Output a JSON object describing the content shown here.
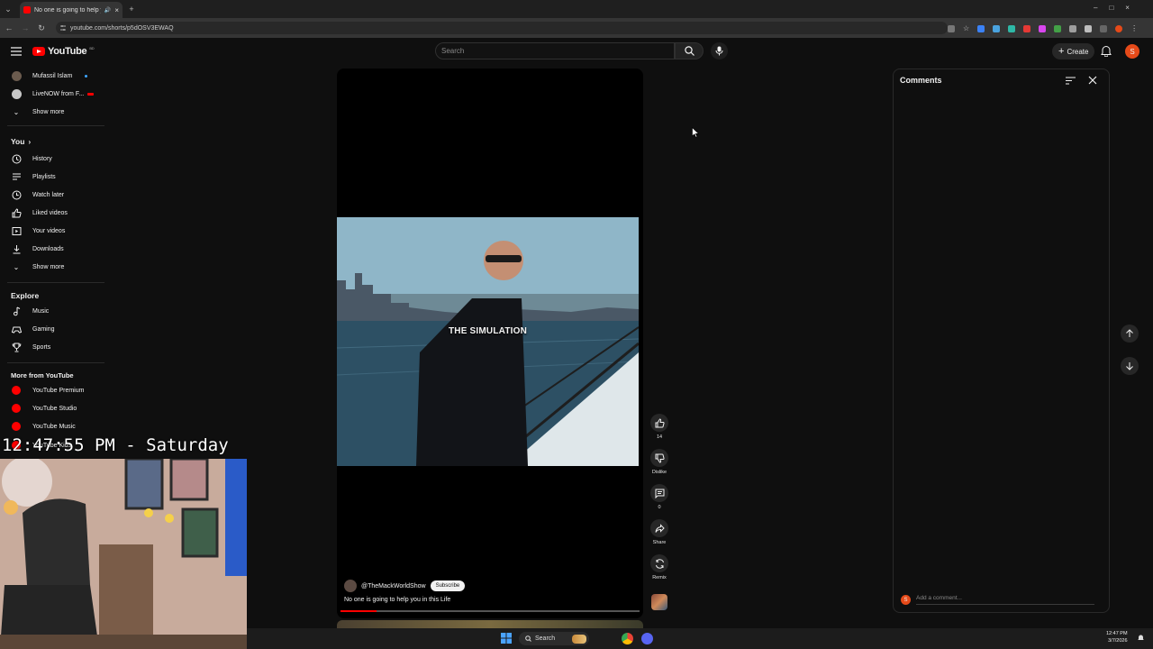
{
  "browser": {
    "tab_title": "No one is going to help you in this Life",
    "new_tab": "+",
    "url": "youtube.com/shorts/p5dOSV3EWAQ",
    "window_controls": [
      "–",
      "□",
      "×"
    ]
  },
  "header": {
    "logo_text": "YouTube",
    "region_badge": "BD",
    "search_placeholder": "Search",
    "create_label": "Create",
    "avatar_letter": "S"
  },
  "sidebar": {
    "subscriptions": [
      {
        "label": "Mufassil Islam",
        "color": "#6b5b4e"
      },
      {
        "label": "LiveNOW from F...",
        "color": "#c7c7c7"
      }
    ],
    "sub_show_more": "Show more",
    "you_heading": "You",
    "you_items": [
      {
        "label": "History",
        "icon": "history-icon"
      },
      {
        "label": "Playlists",
        "icon": "playlists-icon"
      },
      {
        "label": "Watch later",
        "icon": "watch-later-icon"
      },
      {
        "label": "Liked videos",
        "icon": "like-icon"
      },
      {
        "label": "Your videos",
        "icon": "your-videos-icon"
      },
      {
        "label": "Downloads",
        "icon": "download-icon"
      }
    ],
    "you_show_more": "Show more",
    "explore_heading": "Explore",
    "explore_items": [
      {
        "label": "Music",
        "icon": "music-icon"
      },
      {
        "label": "Gaming",
        "icon": "gaming-icon"
      },
      {
        "label": "Sports",
        "icon": "sports-icon"
      }
    ],
    "more_heading": "More from YouTube",
    "more_items": [
      {
        "label": "YouTube Premium"
      },
      {
        "label": "YouTube Studio"
      },
      {
        "label": "YouTube Music"
      },
      {
        "label": "YouTube Kids"
      }
    ]
  },
  "overlay": {
    "clock": "12:47:55 PM - Saturday"
  },
  "video": {
    "caption": "THE SIMULATION",
    "channel": "@TheMackWorldShow",
    "subscribe": "Subscribe",
    "title": "No one is going to help you in this Life",
    "progress": 0.12
  },
  "actions": {
    "like_count": "14",
    "dislike_label": "Dislike",
    "comment_count": "0",
    "share_label": "Share",
    "remix_label": "Remix"
  },
  "comments": {
    "title": "Comments",
    "input_placeholder": "Add a comment...",
    "user_initial": "S"
  },
  "taskbar": {
    "search_label": "Search",
    "time": "12:47 PM",
    "date": "3/7/2026"
  },
  "colors": {
    "brand_red": "#ff0000",
    "background": "#0f0f0f"
  }
}
